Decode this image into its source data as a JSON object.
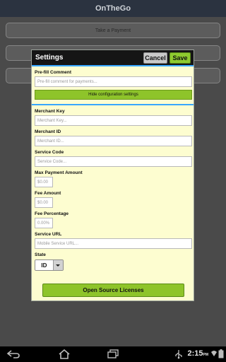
{
  "app": {
    "title": "OnTheGo"
  },
  "background": {
    "take_payment_label": "Take a Payment"
  },
  "dialog": {
    "title": "Settings",
    "cancel_label": "Cancel",
    "save_label": "Save",
    "prefill": {
      "label": "Pre-fill Comment",
      "placeholder": "Pre-fill comment for payments..."
    },
    "hide_config_label": "Hide configuration settings",
    "merchant_key": {
      "label": "Merchant Key",
      "placeholder": "Merchant Key..."
    },
    "merchant_id": {
      "label": "Merchant ID",
      "placeholder": "Merchant ID..."
    },
    "service_code": {
      "label": "Service Code",
      "placeholder": "Service Code..."
    },
    "max_payment": {
      "label": "Max Payment Amount",
      "placeholder": "$0.00"
    },
    "fee_amount": {
      "label": "Fee Amount",
      "placeholder": "$0.00"
    },
    "fee_percentage": {
      "label": "Fee Percentage",
      "placeholder": "0.00%"
    },
    "service_url": {
      "label": "Service URL",
      "placeholder": "Mobile Service URL..."
    },
    "state": {
      "label": "State",
      "value": "ID"
    },
    "oss_label": "Open Source Licenses"
  },
  "status": {
    "time": "2:15",
    "ampm": "PM",
    "icons": [
      "back-icon",
      "home-icon",
      "recent-apps-icon",
      "usb-icon",
      "wifi-icon",
      "battery-icon"
    ]
  },
  "colors": {
    "accent_blue": "#37a7ff",
    "button_green": "#8ec42a",
    "dialog_bg": "#fdfdd0",
    "titlebar": "#2b3340"
  }
}
